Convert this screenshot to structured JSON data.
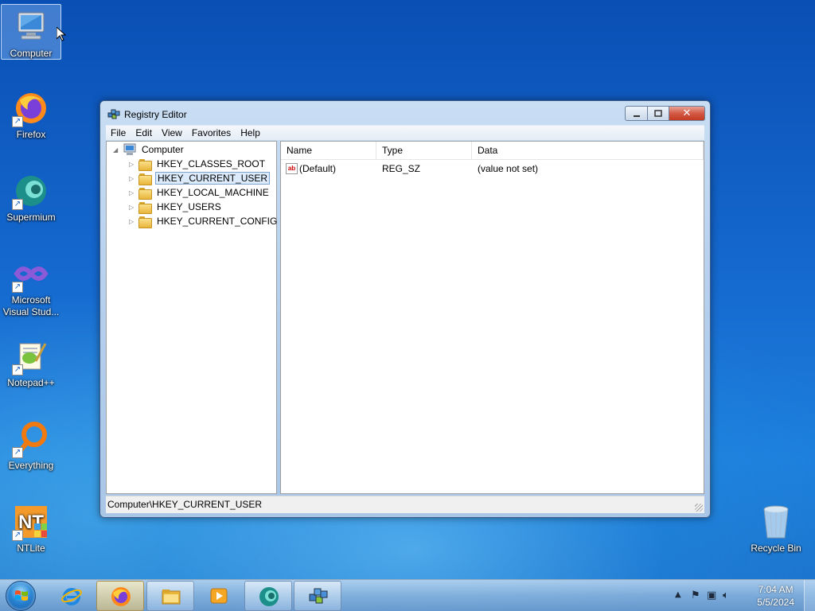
{
  "desktop": {
    "icons": [
      {
        "label": "Computer",
        "icon": "computer-icon"
      },
      {
        "label": "Firefox",
        "icon": "firefox-icon"
      },
      {
        "label": "Supermium",
        "icon": "supermium-icon"
      },
      {
        "label": "Microsoft Visual Stud...",
        "icon": "visual-studio-icon"
      },
      {
        "label": "Notepad++",
        "icon": "notepad-plus-plus-icon"
      },
      {
        "label": "Everything",
        "icon": "everything-search-icon"
      },
      {
        "label": "NTLite",
        "icon": "ntlite-icon"
      },
      {
        "label": "Recycle Bin",
        "icon": "recycle-bin-icon"
      }
    ]
  },
  "window": {
    "title": "Registry Editor",
    "menu": [
      "File",
      "Edit",
      "View",
      "Favorites",
      "Help"
    ],
    "tree": {
      "root": "Computer",
      "keys": [
        "HKEY_CLASSES_ROOT",
        "HKEY_CURRENT_USER",
        "HKEY_LOCAL_MACHINE",
        "HKEY_USERS",
        "HKEY_CURRENT_CONFIG"
      ],
      "selected": "HKEY_CURRENT_USER"
    },
    "list": {
      "columns": [
        "Name",
        "Type",
        "Data"
      ],
      "rows": [
        {
          "name": "(Default)",
          "type": "REG_SZ",
          "data": "(value not set)"
        }
      ]
    },
    "status": "Computer\\HKEY_CURRENT_USER"
  },
  "taskbar": {
    "clock_time": "7:04 AM",
    "clock_date": "5/5/2024",
    "buttons": [
      "internet-explorer-icon",
      "firefox-icon",
      "file-explorer-icon",
      "media-player-icon",
      "supermium-icon",
      "registry-editor-icon"
    ]
  },
  "colors": {
    "selection": "#dcebfc",
    "window_frame": "#b7d1ee",
    "close_button": "#c43a22"
  }
}
